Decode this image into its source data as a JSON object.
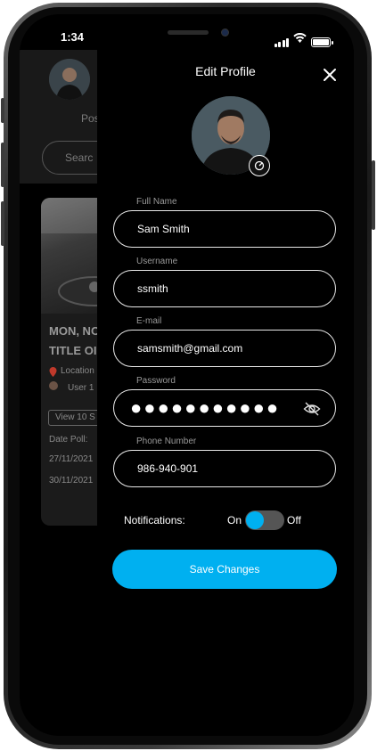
{
  "status_bar": {
    "time": "1:34"
  },
  "background_app": {
    "header_text": "Pos",
    "search_placeholder": "Searc",
    "card": {
      "title_line1": "MON, NO",
      "title_line2": "TITLE OI",
      "location": "Location",
      "user": "User 1",
      "view_button": "View 10 S",
      "date_poll_label": "Date Poll:",
      "date_1": "27/11/2021",
      "date_2": "30/11/2021"
    }
  },
  "drawer": {
    "title": "Edit Profile",
    "fields": {
      "full_name": {
        "label": "Full Name",
        "value": "Sam Smith"
      },
      "username": {
        "label": "Username",
        "value": "ssmith"
      },
      "email": {
        "label": "E-mail",
        "value": "samsmith@gmail.com"
      },
      "password": {
        "label": "Password",
        "value": "●●●●●●●●●●●"
      },
      "phone": {
        "label": "Phone Number",
        "value": "986-940-901"
      }
    },
    "notifications": {
      "label": "Notifications:",
      "on": "On",
      "off": "Off",
      "enabled": true
    },
    "save_label": "Save Changes"
  },
  "colors": {
    "accent": "#00b0f0",
    "background": "#000000",
    "text": "#ffffff",
    "label": "#9a9a9a"
  },
  "icons": [
    "close-icon",
    "edit-icon",
    "eye-off-icon",
    "grid-icon",
    "location-pin-icon",
    "signal-icon",
    "wifi-icon",
    "battery-icon"
  ]
}
